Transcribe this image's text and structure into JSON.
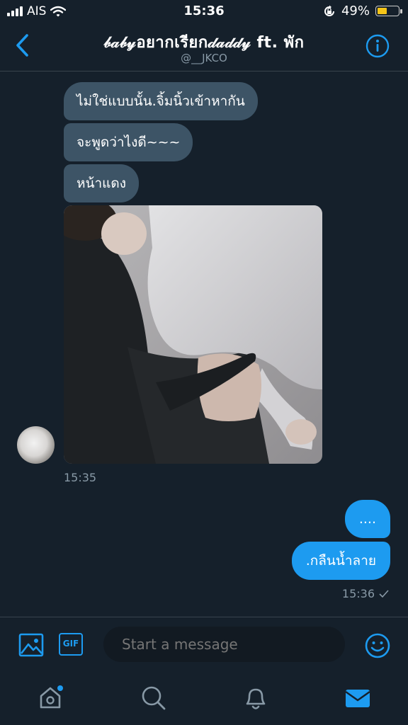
{
  "status_bar": {
    "carrier": "AIS",
    "time": "15:36",
    "battery_percent": "49%",
    "battery_level": 0.49,
    "battery_color": "#f5c518"
  },
  "header": {
    "title": "𝒷𝒶𝒷𝓎อยากเรียก𝒹𝒶𝒹𝒹𝓎 ft. พัก",
    "handle": "@__JKCO",
    "back_icon": "chevron-left-icon",
    "info_icon": "info-icon"
  },
  "messages": {
    "received": [
      {
        "text": "ไม่ใช่แบบนั้น.จิ้มนิ้วเข้าหากัน"
      },
      {
        "text": "จะพูดว่าไงดี~~~"
      },
      {
        "text": "หน้าแดง"
      }
    ],
    "received_time": "15:35",
    "sent": [
      {
        "text": "...."
      },
      {
        "text": ".กลืนน้ำลาย"
      }
    ],
    "sent_time": "15:36",
    "sent_status_icon": "check-icon"
  },
  "composer": {
    "placeholder": "Start a message",
    "image_icon": "image-icon",
    "gif_label": "GIF",
    "emoji_icon": "emoji-icon"
  },
  "tab_bar": {
    "items": [
      "home-icon",
      "search-icon",
      "notifications-icon",
      "messages-icon"
    ],
    "active": "messages-icon"
  },
  "colors": {
    "background": "#15202b",
    "accent": "#1d9bf0",
    "received_bubble": "#3d5466",
    "secondary_text": "#8899a6"
  }
}
